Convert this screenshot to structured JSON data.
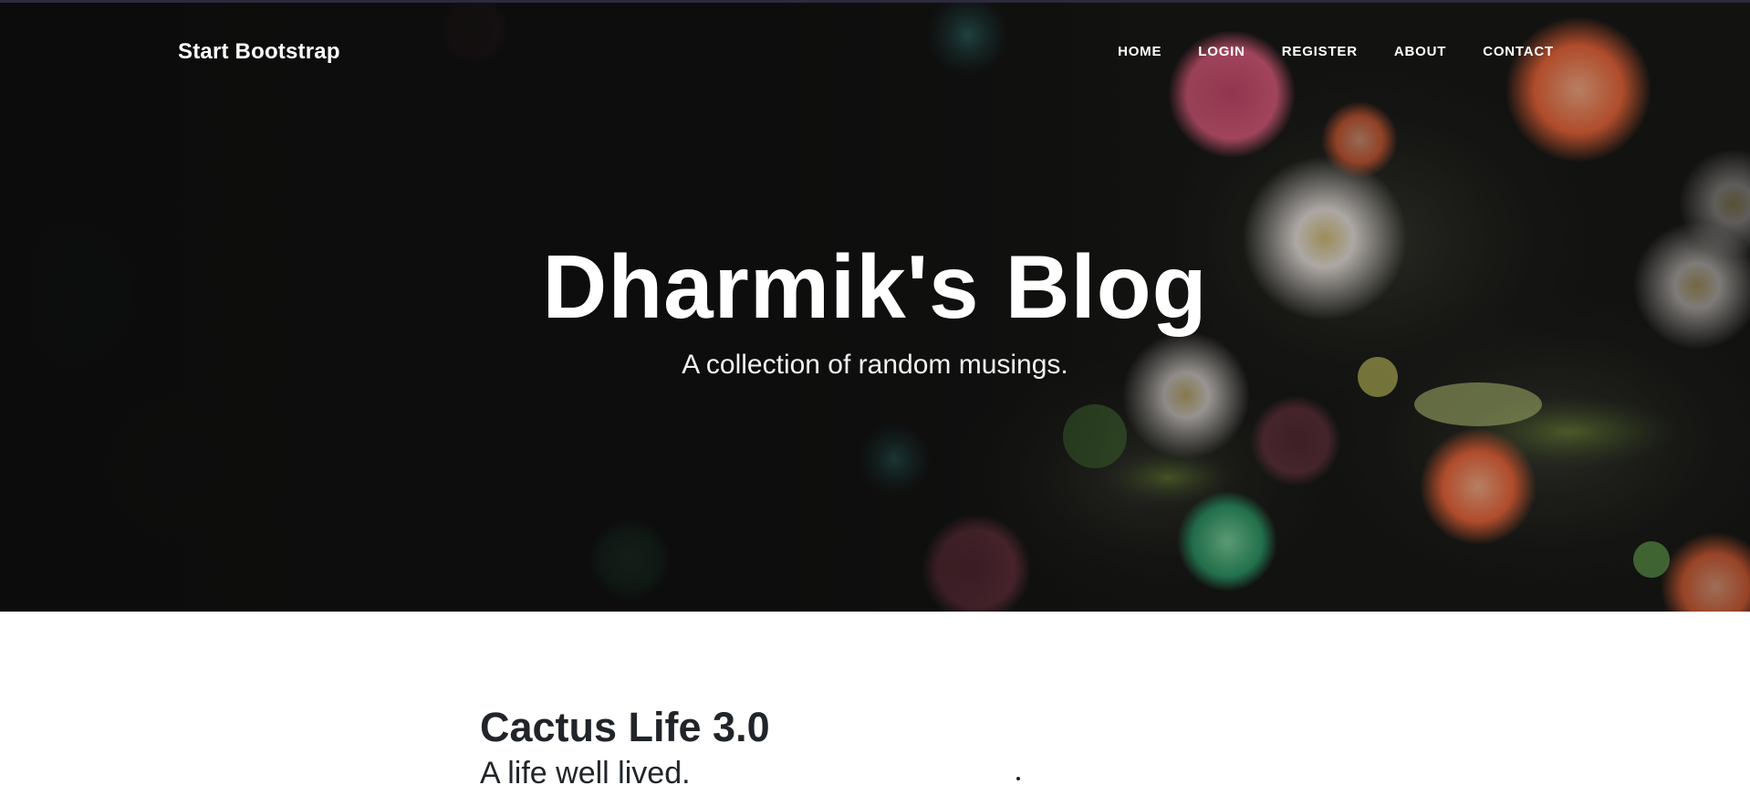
{
  "navbar": {
    "brand": "Start Bootstrap",
    "links": [
      {
        "label": "HOME"
      },
      {
        "label": "LOGIN"
      },
      {
        "label": "REGISTER"
      },
      {
        "label": "ABOUT"
      },
      {
        "label": "CONTACT"
      }
    ]
  },
  "hero": {
    "title": "Dharmik's Blog",
    "subtitle": "A collection of random musings.",
    "background_image": "sea-anemones-photo",
    "colors": {
      "base": "#141414",
      "overlay_text": "#ffffff"
    }
  },
  "posts": [
    {
      "title": "Cactus Life 3.0",
      "subtitle": "A life well lived."
    }
  ],
  "colors": {
    "text_dark": "#212529",
    "page_bg": "#ffffff"
  }
}
